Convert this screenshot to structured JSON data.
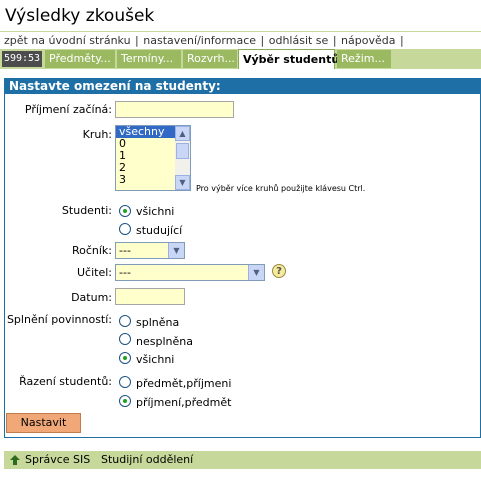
{
  "header": {
    "title": "Výsledky zkoušek"
  },
  "toplinks": [
    {
      "label": "zpět na úvodní stránku"
    },
    {
      "label": "nastavení/informace"
    },
    {
      "label": "odhlásit se"
    },
    {
      "label": "nápověda"
    }
  ],
  "toplinks_sep": "|",
  "tabs": {
    "timer": "599:53",
    "items": [
      {
        "label": "Předměty..."
      },
      {
        "label": "Termíny..."
      },
      {
        "label": "Rozvrh..."
      },
      {
        "label": "Výběr studentů"
      },
      {
        "label": "Režim..."
      }
    ],
    "active": "Výběr studentů"
  },
  "form": {
    "heading": "Nastavte omezení na studenty:",
    "surname_label": "Příjmení začíná:",
    "surname_value": "",
    "group_label": "Kruh:",
    "group_options": [
      "všechny",
      "0",
      "1",
      "2",
      "3"
    ],
    "group_selected": "všechny",
    "group_hint": "Pro výběr více kruhů použijte klávesu Ctrl.",
    "students_label": "Studenti:",
    "students_options": [
      "všichni",
      "studující"
    ],
    "students_selected": "všichni",
    "year_label": "Ročník:",
    "year_value": "---",
    "teacher_label": "Učitel:",
    "teacher_value": "---",
    "help_glyph": "?",
    "date_label": "Datum:",
    "date_value": "",
    "fulfil_label": "Splnění povinností:",
    "fulfil_options": [
      "splněna",
      "nesplněna",
      "všichni"
    ],
    "fulfil_selected": "všichni",
    "sort_label": "Řazení studentů:",
    "sort_options": [
      "předmět,příjmeni",
      "příjmení,předmět"
    ],
    "sort_selected": "příjmení,předmět",
    "submit_label": "Nastavit"
  },
  "footer": {
    "items": [
      {
        "label": "Správce SIS"
      },
      {
        "label": "Studijní oddělení"
      }
    ]
  },
  "colors": {
    "accent_green": "#c6d99b",
    "tab_green": "#9bb961",
    "panel_blue": "#1d6fa6",
    "input_yellow": "#ffffcc",
    "button_orange": "#f1a878"
  }
}
